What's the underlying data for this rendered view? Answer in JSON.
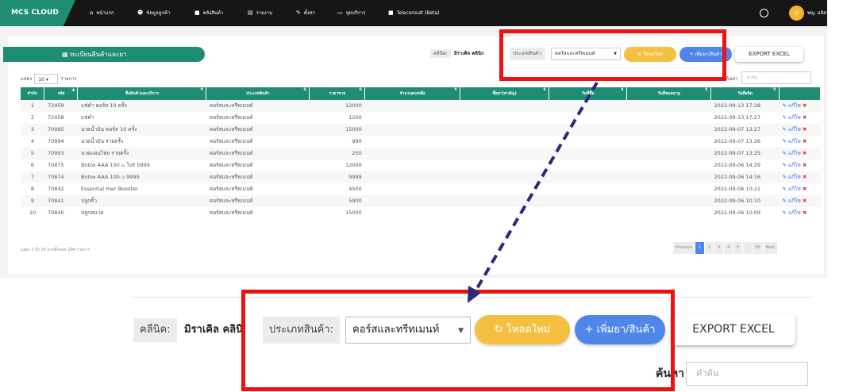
{
  "nav": {
    "brand": "MCS CLOUD",
    "items": [
      {
        "icon": "home-icon",
        "glyph": "⌂",
        "label": "หน้าแรก"
      },
      {
        "icon": "users-icon",
        "glyph": "☻",
        "label": "ข้อมูลลูกค้า"
      },
      {
        "icon": "box-icon",
        "glyph": "■",
        "label": "คลังสินค้า"
      },
      {
        "icon": "chart-icon",
        "glyph": "▤",
        "label": "รายงาน"
      },
      {
        "icon": "wrench-icon",
        "glyph": "✎",
        "label": "ตั้งค่า"
      },
      {
        "icon": "monitor-icon",
        "glyph": "▭",
        "label": "จุดบริการ"
      },
      {
        "icon": "video-icon",
        "glyph": "■",
        "label": "Teleconsult (Beta)"
      }
    ],
    "user_name": "พญ. อลิสา"
  },
  "page": {
    "title": "ทะเบียนสินค้าและยา",
    "clinic_label": "คลินิค:",
    "clinic_value": "มิราเคิล คลินิก",
    "type_label": "ประเภทสินค้า:",
    "type_value": "คอร์สและทรีทเมนท์",
    "reload_label": "โหลดใหม่",
    "add_label": "เพิ่มยา/สินค้า",
    "export_label": "EXPORT EXCEL",
    "show_label": "แสดง",
    "show_value": "10",
    "show_suffix": "รายการ",
    "search_label": "ค้นหา",
    "search_placeholder": "คำค้น"
  },
  "table": {
    "headers": [
      "ลำดับ",
      "รหัส",
      "ชื่อสินค้าและบริการ",
      "ประเภทสินค้า",
      "ราคาขาย",
      "จำนวนคงเหลือ",
      "ซื้อยา(สามัญ)",
      "วันที่ซื้อ",
      "วันที่หมดอายุ",
      "วันที่ผลิต",
      ""
    ],
    "rows": [
      {
        "no": "1",
        "code": "72459",
        "name": "แช่ดำ คอร์ส 10 ครั้ง",
        "type": "คอร์สและทรีทเมนท์",
        "price": "12000",
        "date": "2022-09-13 17:28"
      },
      {
        "no": "2",
        "code": "72458",
        "name": "แช่ดำ",
        "type": "คอร์สและทรีทเมนท์",
        "price": "1200",
        "date": "2022-09-13 17:27"
      },
      {
        "no": "3",
        "code": "70995",
        "name": "นวดน้ำมัน คอร์ส 10 ครั้ง",
        "type": "คอร์สและทรีทเมนท์",
        "price": "15000",
        "date": "2022-09-07 13:27"
      },
      {
        "no": "4",
        "code": "70994",
        "name": "นวดน้ำมัน รายครั้ง",
        "type": "คอร์สและทรีทเมนท์",
        "price": "990",
        "date": "2022-09-07 13:26"
      },
      {
        "no": "5",
        "code": "70993",
        "name": "นวดแผนไทย รายครั้ง",
        "type": "คอร์สและทรีทเมนท์",
        "price": "250",
        "date": "2022-09-07 13:25"
      },
      {
        "no": "6",
        "code": "70875",
        "name": "Botox AAA 100 u โปร 5999",
        "type": "คอร์สและทรีทเมนท์",
        "price": "12000",
        "date": "2022-09-06 14:29"
      },
      {
        "no": "7",
        "code": "70874",
        "name": "Botox AAA 100 u 9999",
        "type": "คอร์สและทรีทเมนท์",
        "price": "9999",
        "date": "2022-09-06 14:16"
      },
      {
        "no": "8",
        "code": "70842",
        "name": "Essential Hair Booster",
        "type": "คอร์สและทรีทเมนท์",
        "price": "4500",
        "date": "2022-09-06 10:21"
      },
      {
        "no": "9",
        "code": "70841",
        "name": "ปลูกคิ้ว",
        "type": "คอร์สและทรีทเมนท์",
        "price": "5900",
        "date": "2022-09-06 10:10"
      },
      {
        "no": "10",
        "code": "70840",
        "name": "ปลูกหนวด",
        "type": "คอร์สและทรีทเมนท์",
        "price": "15000",
        "date": "2022-09-06 10:09"
      }
    ],
    "edit_label": "แก้ไข",
    "delete_glyph": "✖",
    "edit_glyph": "✎"
  },
  "footer": {
    "info": "แสดง 1 ถึง 10 จากทั้งหมด 294 รายการ",
    "pages": [
      "Previous",
      "1",
      "2",
      "3",
      "4",
      "5",
      "...",
      "30",
      "Next"
    ],
    "active_page": "1"
  },
  "zoom": {
    "clinic_label": "คลีนิค:",
    "clinic_value": "มิราเคิล คลินิ",
    "type_label": "ประเภทสินค้า:",
    "type_value": "คอร์สและทรีทเมนท์",
    "reload_label": "โหลดใหม่",
    "add_label": "เพิ่มยา/สินค้า",
    "export_label": "EXPORT EXCEL",
    "search_label": "ค้นหา",
    "search_placeholder": "คำค้น"
  },
  "colors": {
    "brand_green": "#1f8d73",
    "reload_yellow": "#f5c042",
    "add_blue": "#4f86e8",
    "highlight_red": "#ee1111",
    "arrow_navy": "#2b2a7a"
  }
}
